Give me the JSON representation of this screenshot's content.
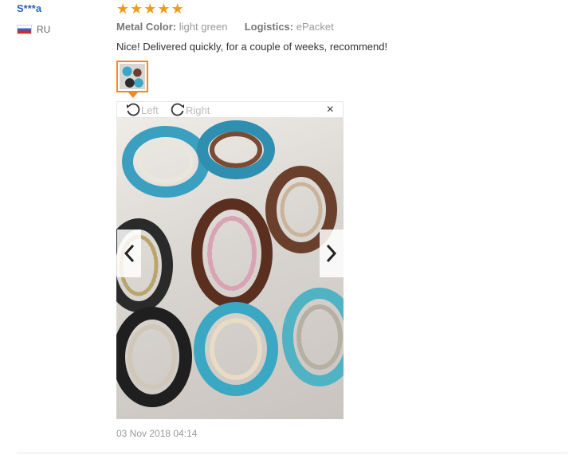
{
  "review": {
    "user": "S***a",
    "country": "RU",
    "rating": 5,
    "color_label": "Metal Color:",
    "color_value": "light green",
    "logistics_label": "Logistics:",
    "logistics_value": "ePacket",
    "text": "Nice! Delivered quickly, for a couple of weeks, recommend!",
    "date": "03 Nov 2018 04:14"
  },
  "viewer": {
    "rotate_left": "Left",
    "rotate_right": "Right",
    "close": "×"
  },
  "colors": {
    "accent": "#f08a24",
    "star": "#f29a1a",
    "username": "#2b63b8"
  }
}
